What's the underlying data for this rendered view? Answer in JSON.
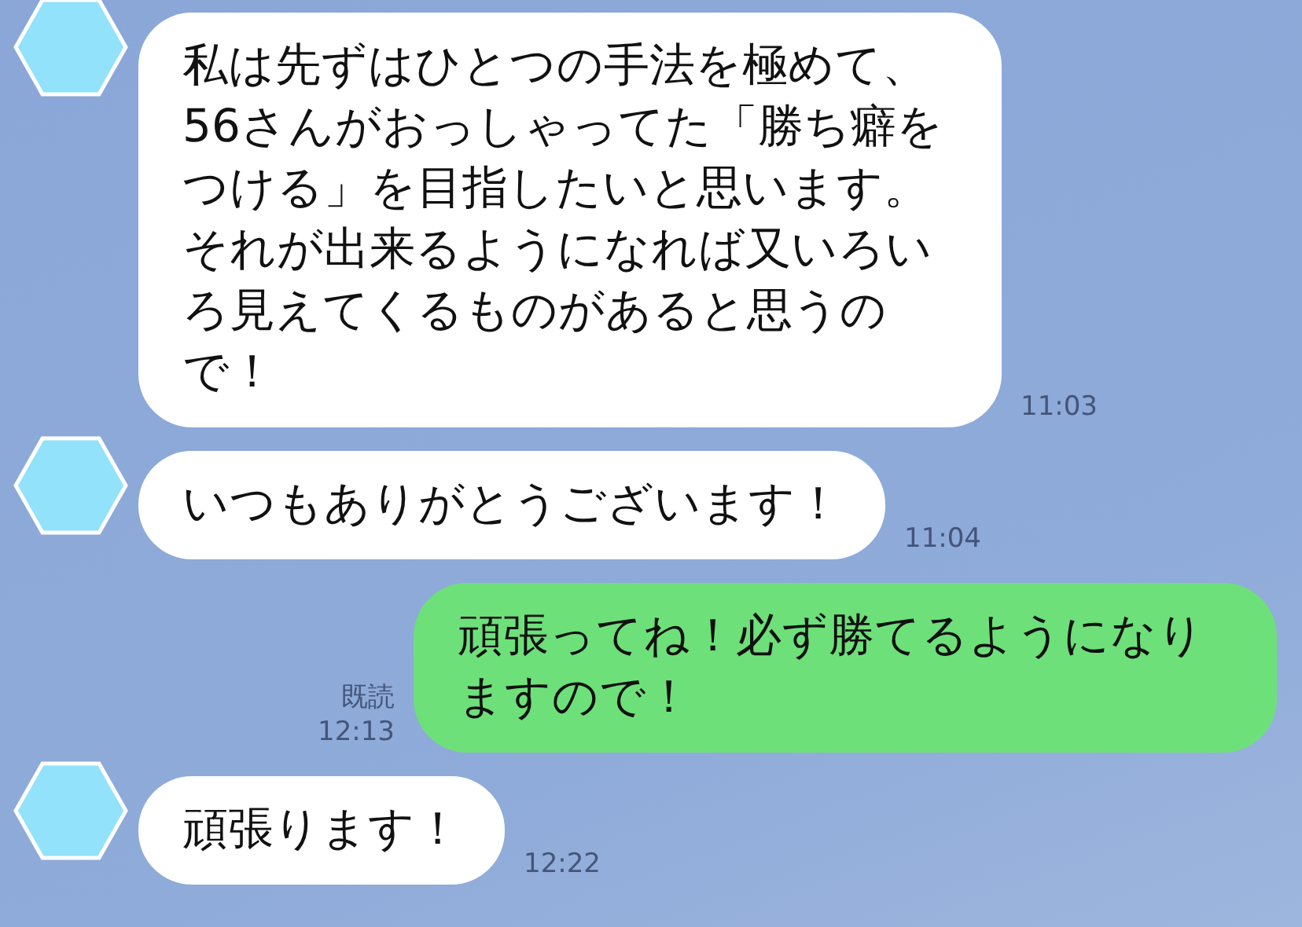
{
  "messages": [
    {
      "kind": "incoming",
      "text": "私は先ずはひとつの手法を極めて、56さんがおっしゃってた「勝ち癖をつける」を目指したいと思います。それが出来るようになれば又いろいろ見えてくるものがあると思うので！",
      "time": "11:03"
    },
    {
      "kind": "incoming",
      "text": "いつもありがとうございます！",
      "time": "11:04"
    },
    {
      "kind": "outgoing",
      "text": "頑張ってね！必ず勝てるようになりますので！",
      "read_label": "既読",
      "time": "12:13"
    },
    {
      "kind": "incoming",
      "text": "頑張ります！",
      "time": "12:22"
    }
  ]
}
